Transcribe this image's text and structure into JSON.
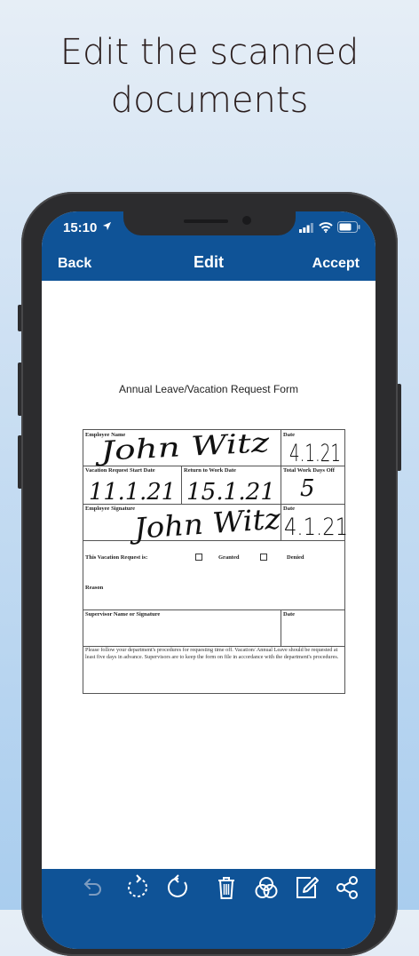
{
  "headline": {
    "line1": "Edit the scanned",
    "line2": "documents"
  },
  "status_bar": {
    "time": "15:10",
    "icons": [
      "location-arrow-icon",
      "signal-icon",
      "wifi-icon",
      "battery-icon"
    ]
  },
  "nav": {
    "back_label": "Back",
    "title": "Edit",
    "accept_label": "Accept"
  },
  "form": {
    "title": "Annual Leave/Vacation Request Form",
    "labels": {
      "employee_name": "Employee Name",
      "date": "Date",
      "start_date": "Vacation Request Start Date",
      "return_date": "Return to Work Date",
      "total_days": "Total Work Days Off",
      "employee_signature": "Employee Signature",
      "request_is": "This Vacation Request is:",
      "granted": "Granted",
      "denied": "Denied",
      "reason": "Reason",
      "supervisor": "Supervisor Name or Signature"
    },
    "handwriting": {
      "name": "John Witz",
      "date1": "4.1.21",
      "start": "11.1.21",
      "return": "15.1.21",
      "days": "5",
      "signature": "John Witz",
      "date2": "4.1.21"
    },
    "note": "Please follow your department's procedures for requesting time off. Vacation/ Annual Leave should be requested at least five days in advance. Supervisors are to keep the form on file in accordance with the department's procedures."
  },
  "toolbar": {
    "items": [
      "undo-icon",
      "rotate-left-icon",
      "rotate-right-icon",
      "trash-icon",
      "filter-icon",
      "edit-icon",
      "share-icon"
    ]
  },
  "colors": {
    "brand_blue": "#0f5397",
    "headline": "#2a1d1d",
    "phone_frame": "#2c2c2e"
  }
}
